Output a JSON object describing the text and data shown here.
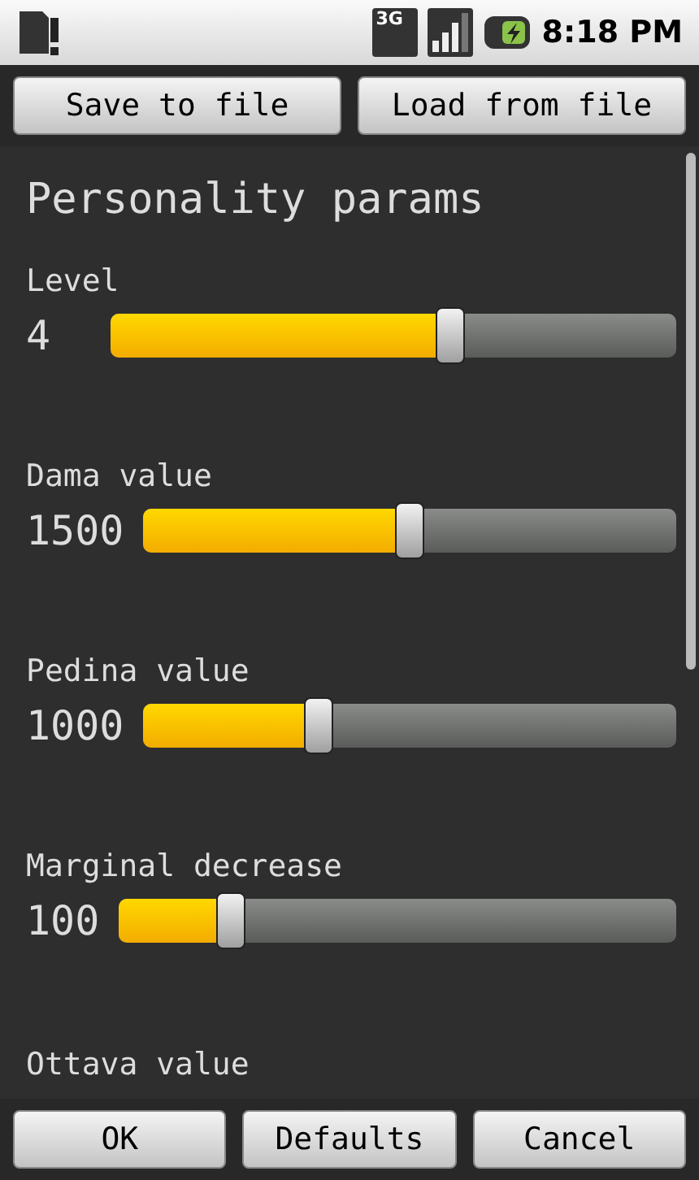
{
  "status_bar": {
    "time": "8:18 PM",
    "network": "3G"
  },
  "top_buttons": [
    "Save to file",
    "Load from file"
  ],
  "title": "Personality params",
  "params": [
    {
      "label": "Level",
      "reading": "4",
      "level": 0.6
    },
    {
      "label": "Dama value",
      "reading": "1500",
      "level": 0.5
    },
    {
      "label": "Pedina value",
      "reading": "1000",
      "level": 0.33
    },
    {
      "label": "Marginal decrease",
      "reading": "100",
      "level": 0.2
    },
    {
      "label": "Ottava value"
    }
  ],
  "bottom_buttons": [
    "OK",
    "Defaults",
    "Cancel"
  ]
}
